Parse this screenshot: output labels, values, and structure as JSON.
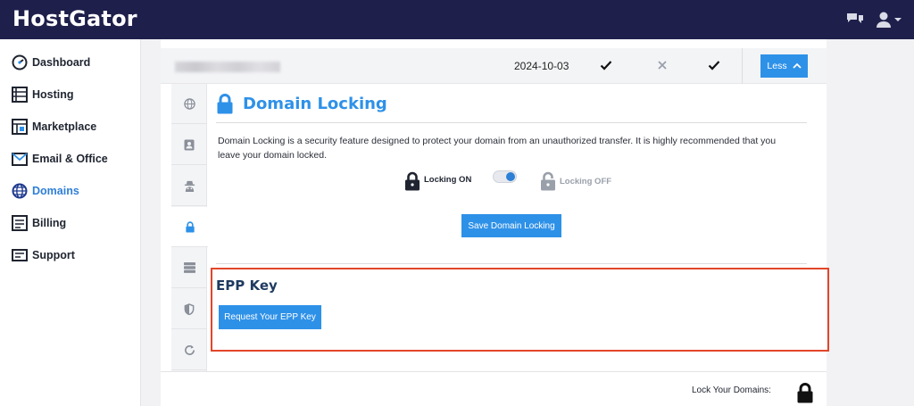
{
  "app": {
    "logo": "HostGator"
  },
  "topbar": {
    "icons": [
      "chat-icon",
      "user-icon"
    ]
  },
  "sidebar": {
    "items": [
      {
        "label": "Dashboard",
        "icon": "dashboard-icon",
        "active": false
      },
      {
        "label": "Hosting",
        "icon": "hosting-icon",
        "active": false
      },
      {
        "label": "Marketplace",
        "icon": "marketplace-icon",
        "active": false
      },
      {
        "label": "Email & Office",
        "icon": "email-icon",
        "active": false
      },
      {
        "label": "Domains",
        "icon": "globe-icon",
        "active": true
      },
      {
        "label": "Billing",
        "icon": "billing-icon",
        "active": false
      },
      {
        "label": "Support",
        "icon": "support-icon",
        "active": false
      }
    ]
  },
  "domain_row": {
    "date": "2024-10-03",
    "col1": "check",
    "col2": "x",
    "col3": "check",
    "less_label": "Less"
  },
  "tabs": [
    "globe-icon",
    "contact-icon",
    "privacy-icon",
    "lock-icon",
    "server-icon",
    "shield-icon",
    "refresh-icon"
  ],
  "domain_locking": {
    "title": "Domain Locking",
    "description": "Domain Locking is a security feature designed to protect your domain from an unauthorized transfer. It is highly recommended that you leave your domain locked.",
    "locking_on_label": "Locking ON",
    "locking_off_label": "Locking OFF",
    "toggle_on": true,
    "save_label": "Save Domain Locking"
  },
  "epp": {
    "title": "EPP Key",
    "button_label": "Request Your EPP Key"
  },
  "footer": {
    "lock_your_domains": "Lock Your Domains:"
  },
  "colors": {
    "topbar": "#1e1f4b",
    "accent": "#2e91e8",
    "highlight": "#e2462a"
  }
}
